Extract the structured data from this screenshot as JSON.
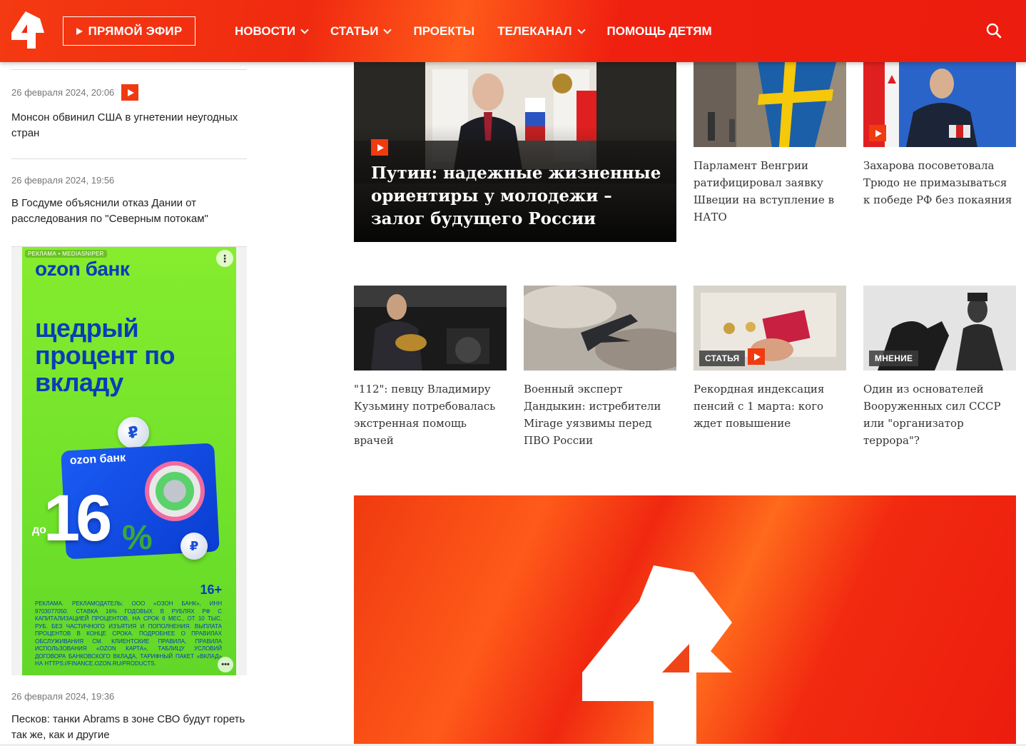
{
  "header": {
    "live_label": "ПРЯМОЙ ЭФИР",
    "nav": [
      {
        "label": "НОВОСТИ",
        "dropdown": true
      },
      {
        "label": "СТАТЬИ",
        "dropdown": true
      },
      {
        "label": "ПРОЕКТЫ",
        "dropdown": false
      },
      {
        "label": "ТЕЛЕКАНАЛ",
        "dropdown": true
      },
      {
        "label": "ПОМОЩЬ ДЕТЯМ",
        "dropdown": false
      }
    ],
    "search_icon": "search-icon",
    "logo_icon": "ren-tv-logo"
  },
  "sidebar": {
    "items": [
      {
        "date": "26 февраля 2024, 20:06",
        "has_video": true,
        "title": "Монсон обвинил США в угнетении неугодных стран"
      },
      {
        "date": "26 февраля 2024, 19:56",
        "has_video": false,
        "title": "В Госдуме объяснили отказ Дании от расследования по \"Северным потокам\""
      },
      {
        "date": "26 февраля 2024, 19:36",
        "has_video": false,
        "title": "Песков: танки Abrams в зоне СВО будут гореть так же, как и другие"
      }
    ]
  },
  "ad": {
    "tag": "РЕКЛАМА • MEDIASNIPER",
    "brand": "ozon банк",
    "headline": "щедрый процент по вкладу",
    "card_brand": "ozon банк",
    "prefix": "до",
    "rate": "16",
    "percent": "%",
    "age": "16+",
    "legal": "РЕКЛАМА. РЕКЛАМОДАТЕЛЬ: ООО «ОЗОН БАНК», ИНН 9703077050. СТАВКА 16% ГОДОВЫХ В РУБЛЯХ РФ С КАПИТАЛИЗАЦИЕЙ ПРОЦЕНТОВ, НА СРОК 6 МЕС., ОТ 10 ТЫС. РУБ. БЕЗ ЧАСТИЧНОГО ИЗЪЯТИЯ И ПОПОЛНЕНИЯ. ВЫПЛАТА ПРОЦЕНТОВ В КОНЦЕ СРОКА. ПОДРОБНЕЕ О ПРАВИЛАХ ОБСЛУЖИВАНИЯ СМ. КЛИЕНТСКИЕ ПРАВИЛА, ПРАВИЛА ИСПОЛЬЗОВАНИЯ «OZON КАРТА», ТАБЛИЦУ УСЛОВИЙ ДОГОВОРА БАНКОВСКОГО ВКЛАДА, ТАРИФНЫЙ ПАКЕТ «ВКЛАД» НА HTTPS://FINANCE.OZON.RU/PRODUCTS.",
    "menu_glyph": "⋮",
    "more_glyph": "•••"
  },
  "hero": {
    "title": "Путин: надежные жизненные ориентиры у молодежи – залог будущего России",
    "has_video": true
  },
  "top_cards": [
    {
      "title": "Парламент Венгрии ратифицировал заявку Швеции на вступление в НАТО",
      "has_video": false
    },
    {
      "title": "Захарова посоветовала Трюдо не примазываться к победе РФ без покаяния",
      "has_video": true
    }
  ],
  "cards": [
    {
      "title": "\"112\": певцу Владимиру Кузьмину потребовалась экстренная помощь врачей",
      "badge": ""
    },
    {
      "title": "Военный эксперт Дандыкин: истребители Mirage уязвимы перед ПВО России",
      "badge": ""
    },
    {
      "title": "Рекордная индексация пенсий с 1 марта: кого ждет повышение",
      "badge": "СТАТЬЯ"
    },
    {
      "title": "Один из основателей Вооруженных сил СССР или \"организатор террора\"?",
      "badge": "МНЕНИЕ"
    }
  ],
  "colors": {
    "brand_red": "#f02a10",
    "ad_green": "#76e42c",
    "ad_blue": "#0a3cb8"
  }
}
